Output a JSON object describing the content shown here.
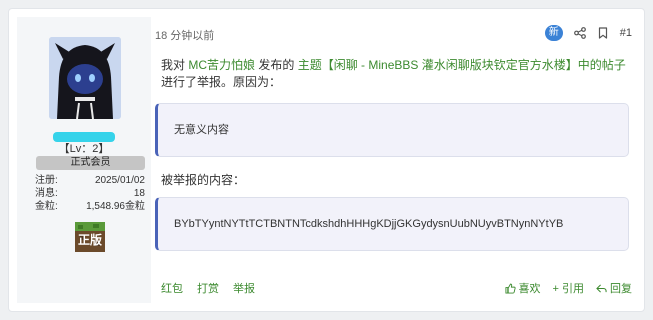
{
  "user": {
    "level": "【Lv：2】",
    "badge": "正式会员",
    "stats": [
      {
        "key": "注册:",
        "value": "2025/01/02"
      },
      {
        "key": "消息:",
        "value": "18"
      },
      {
        "key": "金粒:",
        "value": "1,548.96金粒"
      }
    ],
    "medal_text": "正版"
  },
  "post": {
    "time": "18 分钟以前",
    "new_label": "新",
    "number": "#1",
    "message": {
      "part1": "我对 ",
      "user_link": "MC苦力怕娘",
      "part2": " 发布的 ",
      "thread_link": "主题【闲聊 - MineBBS 灌水闲聊版块钦定官方水楼】中的帖子",
      "part3": " 进行了举报。原因为："
    },
    "reason": "无意义内容",
    "reported_label": "被举报的内容：",
    "reported_content": "BYbTYyntNYTtTCTBNTNTcdkshdhHHHgKDjjGKGydysnUubNUyvBTNynNYtYB"
  },
  "footer": {
    "left": [
      "红包",
      "打赏",
      "举报"
    ],
    "like": "喜欢",
    "quote": "+ 引用",
    "reply": "回复"
  },
  "colors": {
    "link": "#3c8a2f",
    "accent": "#4a63b8",
    "new_badge": "#3b82d6",
    "username": "#35d3ea"
  }
}
